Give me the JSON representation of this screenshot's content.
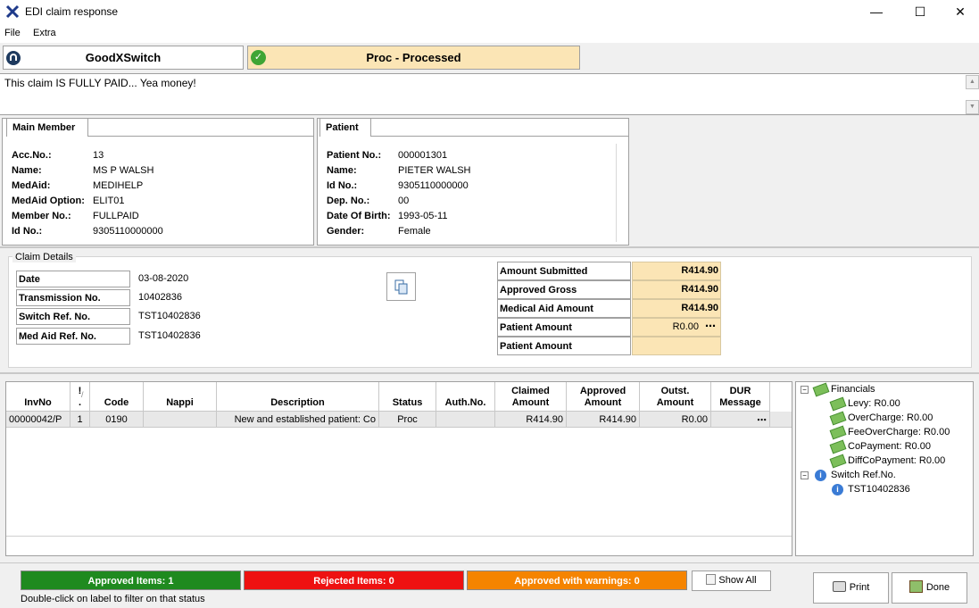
{
  "window": {
    "title": "EDI claim response"
  },
  "menu": [
    "File",
    "Extra"
  ],
  "status": {
    "switch": "GoodXSwitch",
    "proc": "Proc - Processed"
  },
  "message": "This claim IS FULLY PAID... Yea money!",
  "member": {
    "tab": "Main Member",
    "fields": [
      {
        "label": "Acc.No.:",
        "value": "13"
      },
      {
        "label": "Name:",
        "value": "MS P WALSH"
      },
      {
        "label": "MedAid:",
        "value": "MEDIHELP"
      },
      {
        "label": "MedAid Option:",
        "value": "ELIT01"
      },
      {
        "label": "Member No.:",
        "value": "FULLPAID"
      },
      {
        "label": "Id No.:",
        "value": "9305110000000"
      }
    ]
  },
  "patient": {
    "tab": "Patient",
    "fields": [
      {
        "label": "Patient No.:",
        "value": "000001301"
      },
      {
        "label": "Name:",
        "value": "PIETER WALSH"
      },
      {
        "label": "Id No.:",
        "value": "9305110000000"
      },
      {
        "label": "Dep. No.:",
        "value": "00"
      },
      {
        "label": "Date Of Birth:",
        "value": "1993-05-11"
      },
      {
        "label": "Gender:",
        "value": "Female"
      }
    ]
  },
  "claim": {
    "legend": "Claim Details",
    "fields": [
      {
        "label": "Date",
        "value": "03-08-2020"
      },
      {
        "label": "Transmission No.",
        "value": "10402836"
      },
      {
        "label": "Switch Ref. No.",
        "value": "TST10402836"
      },
      {
        "label": "Med Aid Ref. No.",
        "value": "TST10402836"
      }
    ],
    "amounts": [
      {
        "label": "Amount Submitted",
        "value": "R414.90"
      },
      {
        "label": "Approved Gross",
        "value": "R414.90"
      },
      {
        "label": "Medical Aid Amount",
        "value": "R414.90"
      },
      {
        "label": "Patient Amount",
        "value": "R0.00"
      },
      {
        "label": "Patient Amount",
        "value": ""
      }
    ],
    "ellipsis": "⋯"
  },
  "grid": {
    "headers": {
      "invno": "InvNo",
      "seq_top": "!",
      "seq_bottom": ".",
      "seq_extra": "/",
      "code": "Code",
      "nappi": "Nappi",
      "description": "Description",
      "status": "Status",
      "auth": "Auth.No.",
      "claimed_1": "Claimed",
      "claimed_2": "Amount",
      "approved_1": "Approved",
      "approved_2": "Amount",
      "outst_1": "Outst.",
      "outst_2": "Amount",
      "dur_1": "DUR",
      "dur_2": "Message"
    },
    "row": {
      "invno": "00000042/P",
      "seq": "1",
      "code": "0190",
      "nappi": "",
      "description": "New and established patient: Co",
      "status": "Proc",
      "auth": "",
      "claimed": "R414.90",
      "approved": "R414.90",
      "outst": "R0.00",
      "dur": "⋯"
    }
  },
  "tree": {
    "financials": "Financials",
    "items": [
      "Levy: R0.00",
      "OverCharge: R0.00",
      "FeeOverCharge: R0.00",
      "CoPayment: R0.00",
      "DiffCoPayment: R0.00"
    ],
    "switch_ref": "Switch Ref.No.",
    "switch_ref_value": "TST10402836",
    "collapse_glyph": "−",
    "info_glyph": "i"
  },
  "footer": {
    "approved": "Approved Items: 1",
    "rejected": "Rejected Items: 0",
    "warnings": "Approved with warnings: 0",
    "show_all": "Show All",
    "hint": "Double-click on label to filter on that status",
    "print": "Print",
    "done": "Done"
  },
  "colors": {
    "approved": "#1f8a1f",
    "rejected": "#ee1111",
    "warnings": "#f58400",
    "highlight": "#fbe5b5"
  },
  "icons": [
    "app-icon",
    "minimize-icon",
    "maximize-icon",
    "close-icon",
    "switch-icon",
    "check-icon",
    "copy-icon",
    "money-icon",
    "info-icon",
    "print-icon",
    "done-icon",
    "show-all-icon"
  ]
}
